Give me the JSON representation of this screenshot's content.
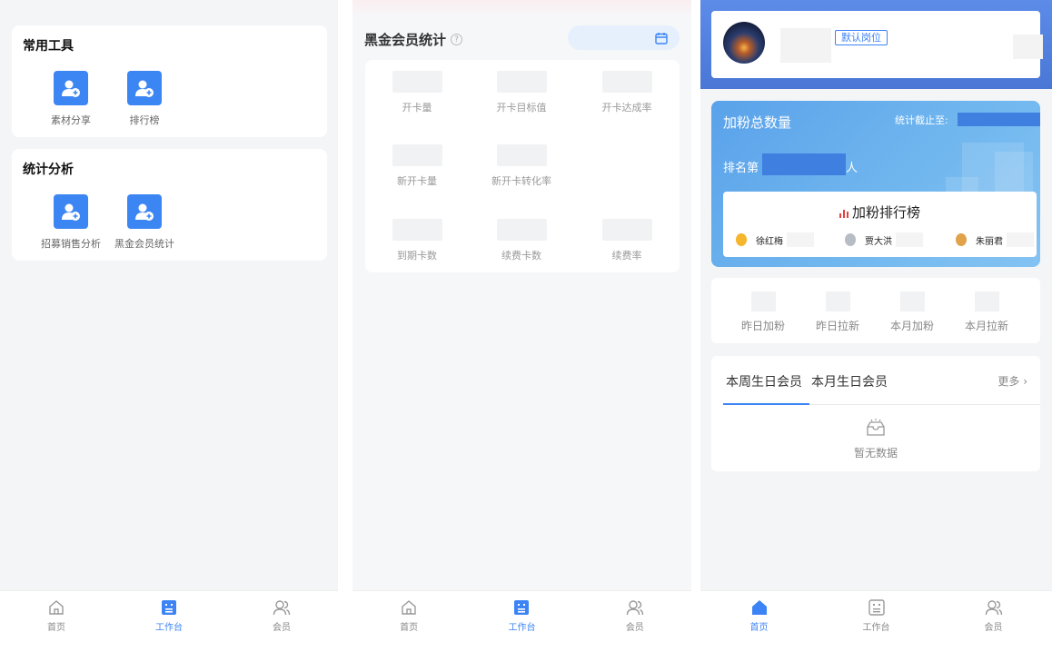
{
  "screen1": {
    "sections": [
      {
        "title": "常用工具",
        "tools": [
          {
            "label": "素材分享"
          },
          {
            "label": "排行榜"
          }
        ]
      },
      {
        "title": "统计分析",
        "tools": [
          {
            "label": "招募销售分析"
          },
          {
            "label": "黑金会员统计"
          }
        ]
      }
    ],
    "tabbar": [
      {
        "label": "首页"
      },
      {
        "label": "工作台",
        "active": true
      },
      {
        "label": "会员"
      }
    ]
  },
  "screen2": {
    "title": "黑金会员统计",
    "stats": [
      {
        "label": "开卡量"
      },
      {
        "label": "开卡目标值"
      },
      {
        "label": "开卡达成率"
      },
      {
        "label": "新开卡量"
      },
      {
        "label": "新开卡转化率"
      },
      {
        "label": "到期卡数"
      },
      {
        "label": "续费卡数"
      },
      {
        "label": "续费率"
      }
    ],
    "tabbar": [
      {
        "label": "首页"
      },
      {
        "label": "工作台",
        "active": true
      },
      {
        "label": "会员"
      }
    ]
  },
  "screen3": {
    "position_badge": "默认岗位",
    "fans": {
      "title": "加粉总数量",
      "cutoff_label": "统计截止至:",
      "rank_prefix": "排名第",
      "rank_suffix": "人",
      "board_title": "加粉排行榜",
      "leaders": [
        {
          "name": "徐红梅",
          "medal": "gold"
        },
        {
          "name": "贾大洪",
          "medal": "silver"
        },
        {
          "name": "朱丽君",
          "medal": "bronze"
        }
      ]
    },
    "stats": [
      {
        "label": "昨日加粉"
      },
      {
        "label": "昨日拉新"
      },
      {
        "label": "本月加粉"
      },
      {
        "label": "本月拉新"
      }
    ],
    "birthday": {
      "tabs": [
        {
          "label": "本周生日会员",
          "active": true
        },
        {
          "label": "本月生日会员"
        }
      ],
      "more": "更多",
      "empty_text": "暂无数据"
    },
    "tabbar": [
      {
        "label": "首页",
        "active": true
      },
      {
        "label": "工作台"
      },
      {
        "label": "会员"
      }
    ]
  },
  "colors": {
    "accent": "#3c84f5",
    "tool_icon_bg": "#3c86f4",
    "gold": "#f5b52c",
    "silver": "#b8bcc4",
    "bronze": "#e0a24a"
  }
}
